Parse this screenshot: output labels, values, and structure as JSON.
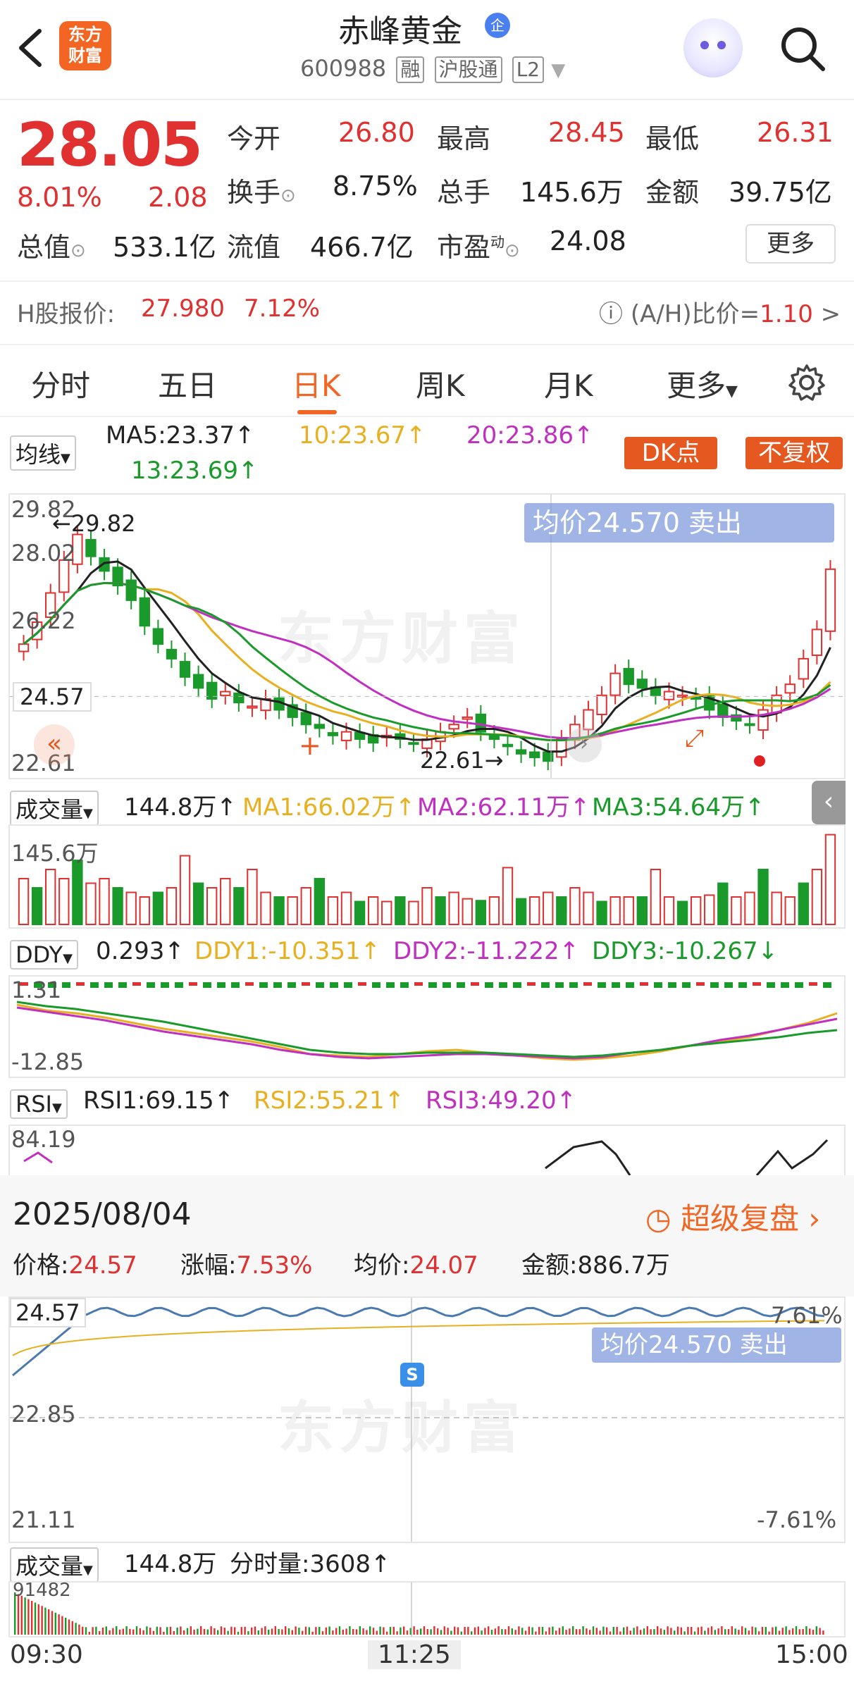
{
  "header": {
    "logo_line1": "东方",
    "logo_line2": "财富",
    "title": "赤峰黄金",
    "enterprise_badge": "企",
    "code": "600988",
    "tags": [
      "融",
      "沪股通",
      "L2"
    ]
  },
  "quote": {
    "price": "28.05",
    "change_pct": "8.01%",
    "change": "2.08",
    "rows": [
      [
        {
          "label": "今开",
          "value": "26.80",
          "color": "red"
        },
        {
          "label": "最高",
          "value": "28.45",
          "color": "red"
        },
        {
          "label": "最低",
          "value": "26.31",
          "color": "red"
        }
      ],
      [
        {
          "label": "换手",
          "value": "8.75%",
          "color": "black"
        },
        {
          "label": "总手",
          "value": "145.6万",
          "color": "black"
        },
        {
          "label": "金额",
          "value": "39.75亿",
          "color": "black"
        }
      ]
    ],
    "total_value_label": "总值",
    "total_value": "533.1亿",
    "float_value_label": "流值",
    "float_value": "466.7亿",
    "pe_label": "市盈",
    "pe_superscript": "动",
    "pe_value": "24.08",
    "more_button": "更多",
    "h_share_label": "H股报价:",
    "h_share_price": "27.980",
    "h_share_pct": "7.12%",
    "ah_ratio_label": "(A/H)比价=",
    "ah_ratio_value": "1.10",
    "ah_arrow": ">"
  },
  "tabs": [
    {
      "label": "分时",
      "active": false
    },
    {
      "label": "五日",
      "active": false
    },
    {
      "label": "日K",
      "active": true
    },
    {
      "label": "周K",
      "active": false
    },
    {
      "label": "月K",
      "active": false
    },
    {
      "label": "更多",
      "active": false
    }
  ],
  "ma_row": {
    "selector": "均线",
    "ma5": "MA5:23.37↑",
    "ma10": "10:23.67↑",
    "ma20": "20:23.86↑",
    "ma13": "13:23.69↑",
    "dk_button": "DK点",
    "fq_button": "不复权"
  },
  "kline": {
    "y_labels": [
      "29.82",
      "28.02",
      "26.22",
      "24.57",
      "22.61"
    ],
    "high_annotation": "29.82",
    "low_annotation": "22.61",
    "avg_bubble": "均价24.570  卖出",
    "watermark": "东方财富"
  },
  "volume": {
    "selector": "成交量",
    "current": "144.8万↑",
    "ma1": "MA1:66.02万↑",
    "ma2": "MA2:62.11万↑",
    "ma3": "MA3:54.64万↑",
    "y_label": "145.6万"
  },
  "ddy": {
    "selector": "DDY",
    "current": "0.293↑",
    "ddy1": "DDY1:-10.351↑",
    "ddy2": "DDY2:-11.222↑",
    "ddy3": "DDY3:-10.267↓",
    "y_top": "1.31",
    "y_bottom": "-12.85"
  },
  "rsi": {
    "selector": "RSI",
    "rsi1": "RSI1:69.15↑",
    "rsi2": "RSI2:55.21↑",
    "rsi3": "RSI3:49.20↑",
    "y_top": "84.19"
  },
  "intraday": {
    "date": "2025/08/04",
    "review": "超级复盘",
    "price_label": "价格:",
    "price": "24.57",
    "change_label": "涨幅:",
    "change": "7.53%",
    "avg_label": "均价:",
    "avg": "24.07",
    "amount_label": "金额:",
    "amount": "886.7万",
    "y_top": "24.57",
    "y_mid": "22.85",
    "y_bottom": "21.11",
    "pct_top": "7.61%",
    "pct_bottom": "-7.61%",
    "avg_bubble": "均价24.570  卖出",
    "vol_selector": "成交量",
    "vol_total": "144.8万",
    "vol_minute": "分时量:3608↑",
    "vol_y": "91482",
    "times": [
      "09:30",
      "11:25",
      "15:00"
    ]
  },
  "colors": {
    "up": "#e03030",
    "down": "#1a9a2a",
    "accent": "#f26522",
    "ma5": "#222222",
    "ma10": "#e8b020",
    "ma20": "#c030c0",
    "ma13": "#1a9a2a"
  }
}
